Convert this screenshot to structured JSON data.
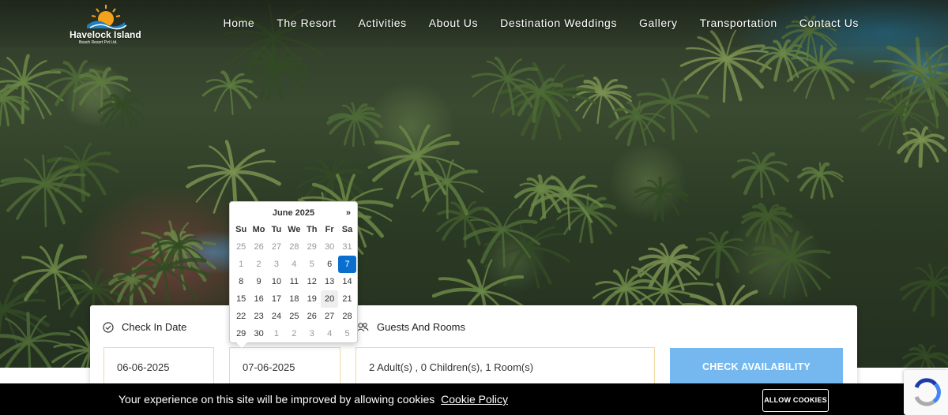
{
  "header": {
    "logo_title": "Havelock Island",
    "logo_subtitle": "Beach Resort Pvt Ltd.",
    "nav": [
      "Home",
      "The Resort",
      "Activities",
      "About Us",
      "Destination Weddings",
      "Gallery",
      "Transportation",
      "Contact Us"
    ]
  },
  "booking": {
    "check_in_label": "Check In Date",
    "check_in_value": "06-06-2025",
    "check_out_value": "07-06-2025",
    "guests_label": "Guests And Rooms",
    "guests_value": "2 Adult(s) , 0 Children(s), 1 Room(s)",
    "check_button": "CHECK AVAILABILITY"
  },
  "datepicker": {
    "title": "June 2025",
    "next": "»",
    "dow": [
      "Su",
      "Mo",
      "Tu",
      "We",
      "Th",
      "Fr",
      "Sa"
    ],
    "weeks": [
      [
        "25",
        "26",
        "27",
        "28",
        "29",
        "30",
        "31"
      ],
      [
        "1",
        "2",
        "3",
        "4",
        "5",
        "6",
        "7"
      ],
      [
        "8",
        "9",
        "10",
        "11",
        "12",
        "13",
        "14"
      ],
      [
        "15",
        "16",
        "17",
        "18",
        "19",
        "20",
        "21"
      ],
      [
        "22",
        "23",
        "24",
        "25",
        "26",
        "27",
        "28"
      ],
      [
        "29",
        "30",
        "1",
        "2",
        "3",
        "4",
        "5"
      ]
    ],
    "selected_day": "7",
    "hover_day": "20"
  },
  "cookie": {
    "text": "Your experience on this site will be improved by allowing cookies",
    "link": "Cookie Policy",
    "button": "ALLOW COOKIES"
  },
  "colors": {
    "accent_button": "#74b8ef",
    "selected_day": "#0a6ecf",
    "field_border": "#f0d9a5"
  }
}
